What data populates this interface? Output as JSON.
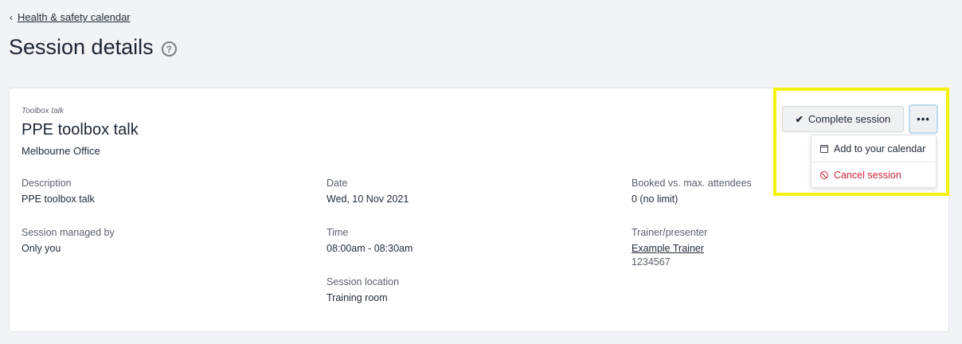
{
  "breadcrumb": {
    "back_label": "Health & safety calendar"
  },
  "page": {
    "title": "Session details"
  },
  "session": {
    "type": "Toolbox talk",
    "title": "PPE toolbox talk",
    "venue": "Melbourne Office"
  },
  "fields": {
    "description": {
      "label": "Description",
      "value": "PPE toolbox talk"
    },
    "managed_by": {
      "label": "Session managed by",
      "value": "Only you"
    },
    "date": {
      "label": "Date",
      "value": "Wed, 10 Nov 2021"
    },
    "time": {
      "label": "Time",
      "value": "08:00am - 08:30am"
    },
    "location": {
      "label": "Session location",
      "value": "Training room"
    },
    "attendees": {
      "label": "Booked vs. max. attendees",
      "value": "0 (no limit)"
    },
    "trainer": {
      "label": "Trainer/presenter",
      "value": "Example Trainer",
      "sub": "1234567"
    }
  },
  "actions": {
    "complete_label": "Complete session",
    "more_label": "•••",
    "menu": [
      {
        "label": "Add to your calendar",
        "icon": "calendar-icon"
      },
      {
        "label": "Cancel session",
        "icon": "cancel-icon",
        "color": "#d2243b"
      }
    ]
  },
  "colors": {
    "highlight": "#f4f20c",
    "danger": "#d2243b",
    "background": "#f2f3f6"
  }
}
